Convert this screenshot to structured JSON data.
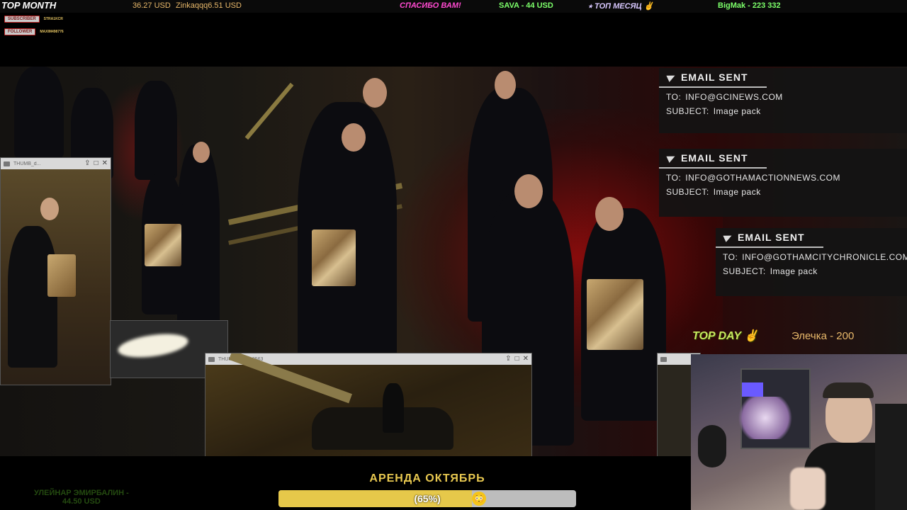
{
  "top_bar": {
    "title": "TOP MONTH",
    "amount_1": "36.27 USD",
    "amount_2": "Zinkaqqq6.51 USD",
    "thanks": "СПАСИБО ВАМ!",
    "sava": "SAVA - 44 USD",
    "top_month_ru": "⭑ ТОП МЕСЯЦ ✌",
    "bigmak": "BigMak - 223 332"
  },
  "alerts": [
    {
      "badge": "SUBSCRIBER",
      "name": "STRA1KCR"
    },
    {
      "badge": "FOLLOWER",
      "name": "MAXIM498776"
    }
  ],
  "thumbnails": {
    "left_title": "THUMB_d...",
    "bottom_title": "THUMB_drive_0563"
  },
  "emails": [
    {
      "title": "EMAIL SENT",
      "to_label": "TO:",
      "to": "INFO@GCINEWS.COM",
      "subject_label": "SUBJECT:",
      "subject": "Image pack"
    },
    {
      "title": "EMAIL SENT",
      "to_label": "TO:",
      "to": "INFO@GOTHAMACTIONNEWS.COM",
      "subject_label": "SUBJECT:",
      "subject": "Image pack"
    },
    {
      "title": "EMAIL SENT",
      "to_label": "TO:",
      "to": "INFO@GOTHAMCITYCHRONICLE.COM",
      "subject_label": "SUBJECT:",
      "subject": "Image pack"
    }
  ],
  "top_day": {
    "label": "TOP DAY ✌",
    "name": "Элечка - 200"
  },
  "goal": {
    "title": "АРЕНДА ОКТЯБРЬ",
    "percent_text": "(65%)",
    "progress": 0.65,
    "emoji": "😳"
  },
  "faded_text": "УЛЕЙНАР ЭМИРБАЛИН -\n44.50 USD",
  "colors": {
    "goal_fill": "#e6c84a",
    "email_bg": "#141414",
    "top_day": "#c8e860"
  }
}
